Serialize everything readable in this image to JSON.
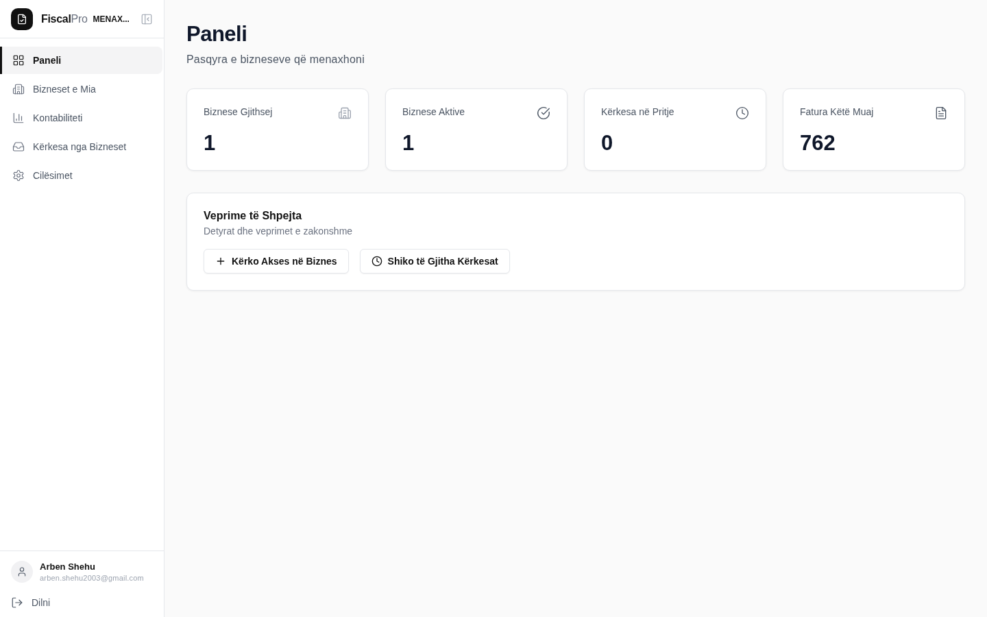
{
  "sidebar": {
    "brand": "**Fiscal**Pro",
    "role_badge": "MENAX...",
    "nav_items": [
      {
        "label": "Paneli",
        "selected": true
      },
      {
        "label": "Bizneset e Mia",
        "selected": false
      },
      {
        "label": "Kontabiliteti",
        "selected": false
      },
      {
        "label": "Kërkesa nga Bizneset",
        "selected": false
      },
      {
        "label": "Cilësimet",
        "selected": false
      }
    ],
    "user": {
      "name": "Arben Shehu",
      "email": "arben.shehu2003@gmail.com"
    },
    "logout": "Dilni"
  },
  "page": {
    "title": "Paneli",
    "subtitle": "Pasqyra e bizneseve që menaxhoni"
  },
  "stats": [
    {
      "label": "Biznese Gjithsej",
      "value": "1"
    },
    {
      "label": "Biznese Aktive",
      "value": "1"
    },
    {
      "label": "Kërkesa në Pritje",
      "value": "0"
    },
    {
      "label": "Fatura Këtë Muaj",
      "value": "762"
    }
  ],
  "quick_actions": {
    "title": "Veprime të Shpejta",
    "subtitle": "Detyrat dhe veprimet e zakonshme",
    "buttons": [
      "Kërko Akses në Biznes",
      "Shiko të Gjitha Kërkesat"
    ]
  }
}
